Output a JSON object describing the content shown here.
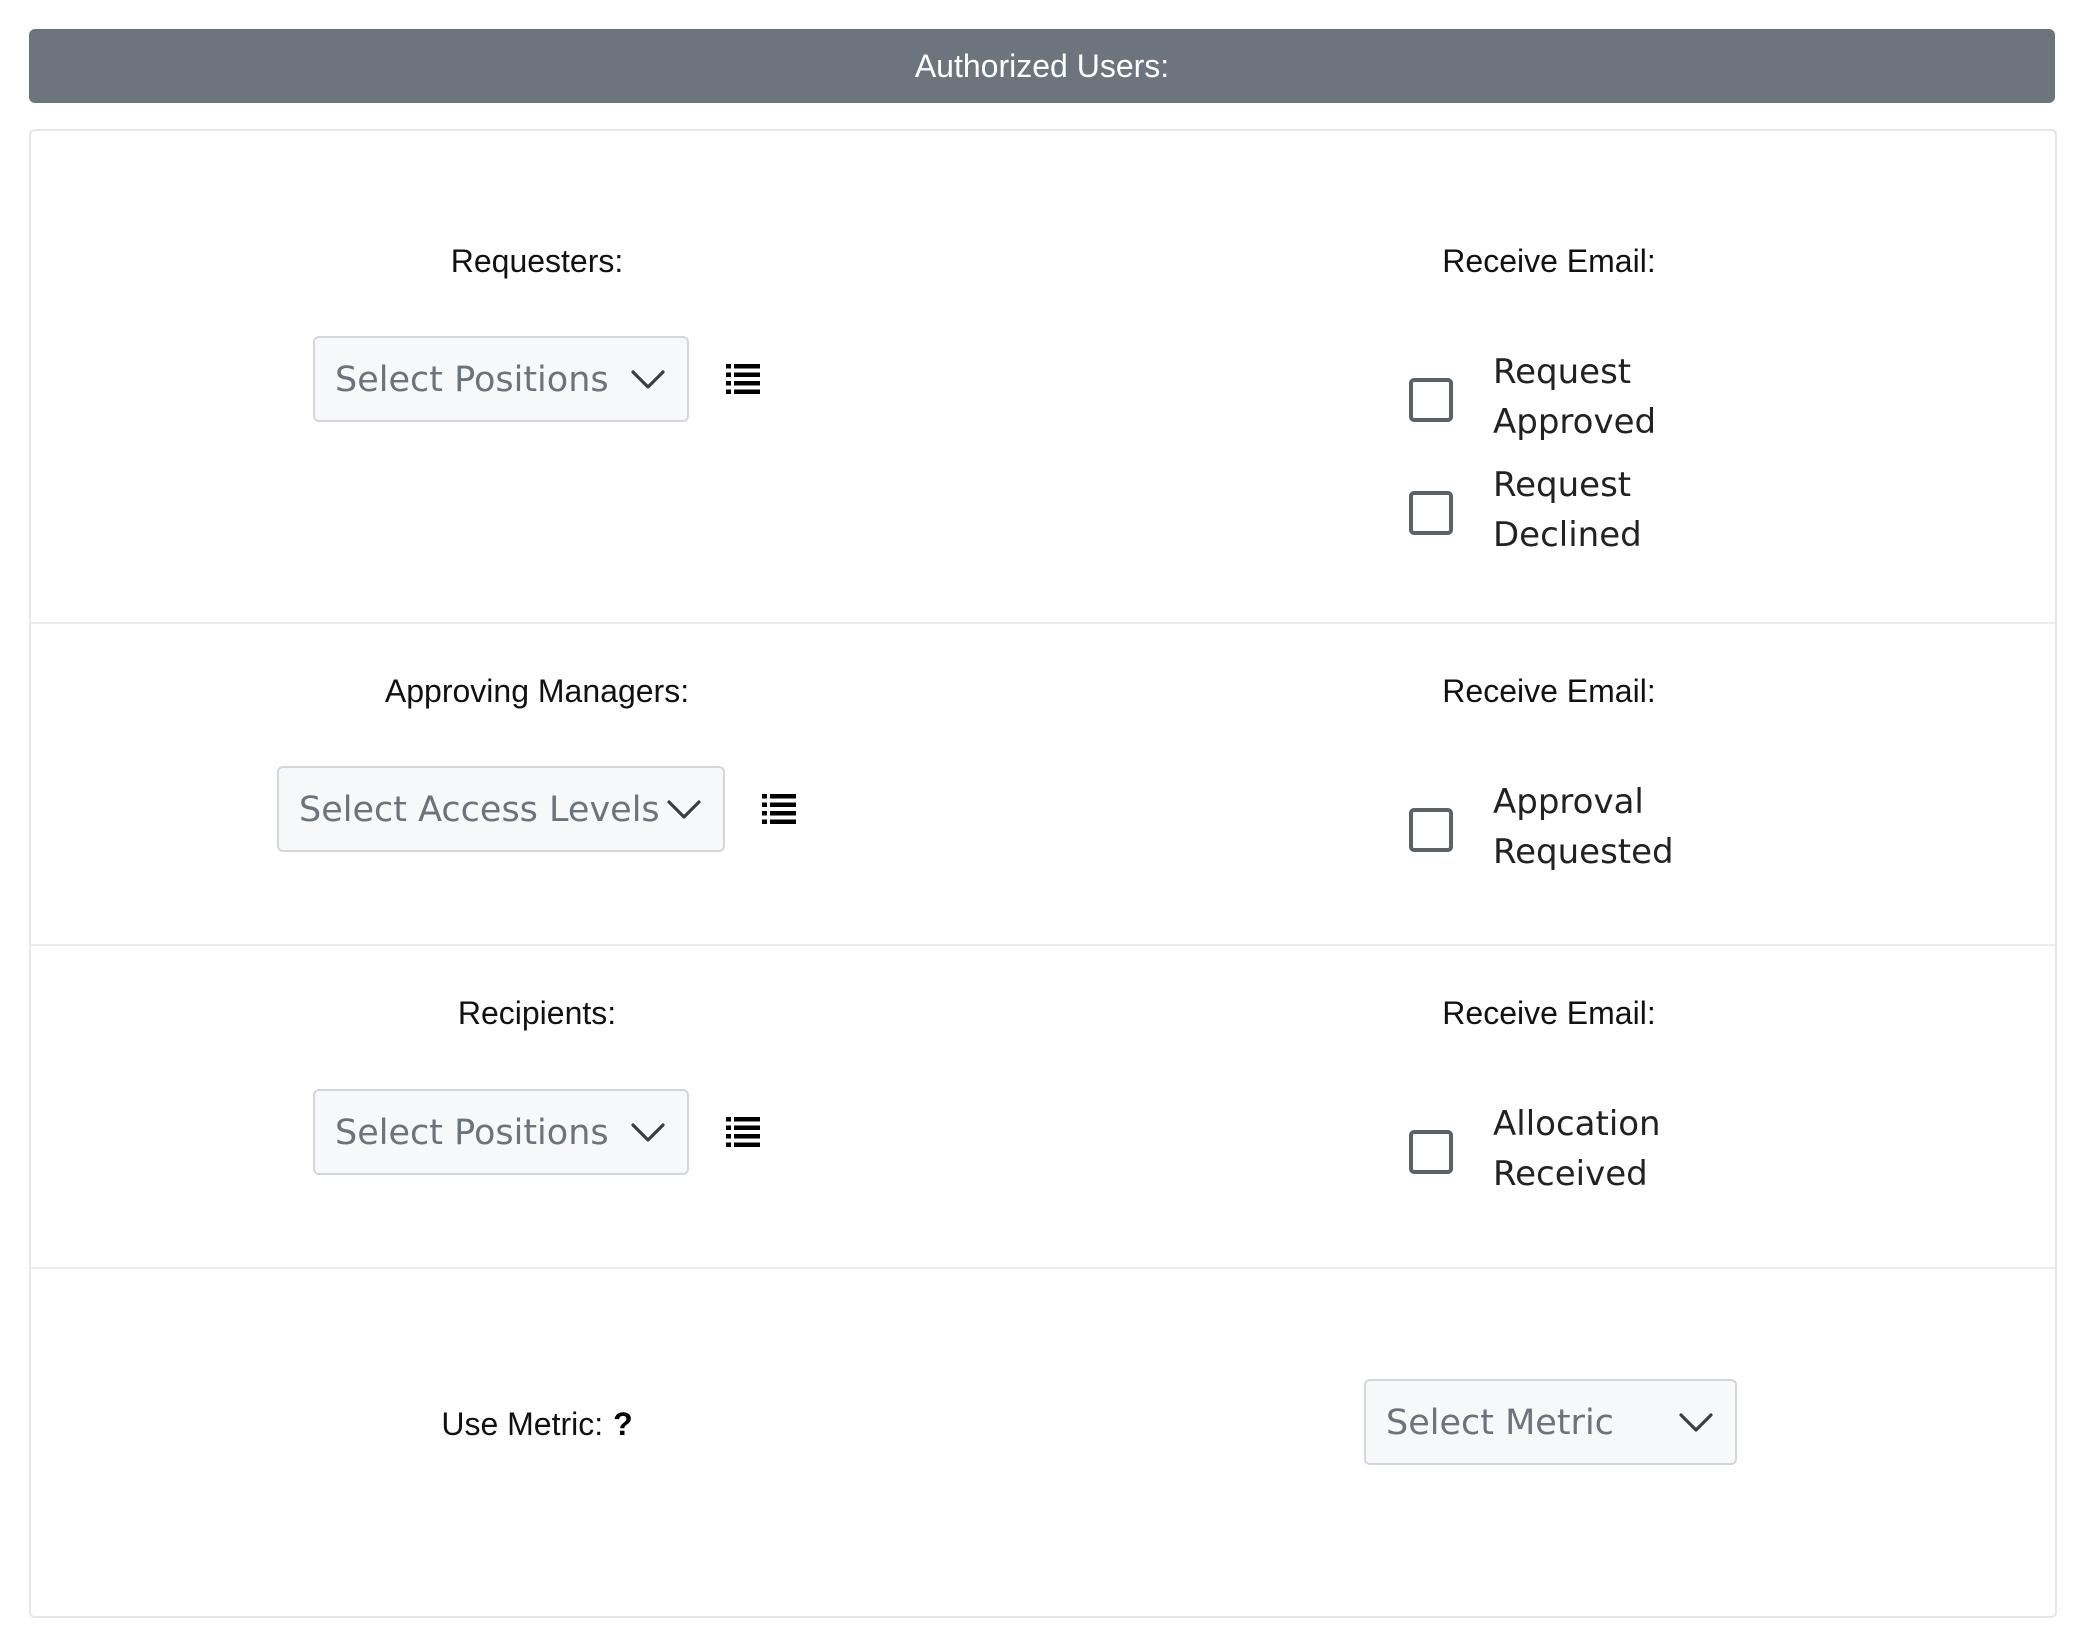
{
  "header": {
    "title": "Authorized Users:"
  },
  "sections": {
    "requesters": {
      "label": "Requesters:",
      "select_placeholder": "Select Positions",
      "email_label": "Receive Email:",
      "checkboxes": [
        {
          "label": "Request Approved",
          "checked": false
        },
        {
          "label": "Request Declined",
          "checked": false
        }
      ]
    },
    "approving_managers": {
      "label": "Approving Managers:",
      "select_placeholder": "Select Access Levels",
      "email_label": "Receive Email:",
      "checkboxes": [
        {
          "label": "Approval Requested",
          "checked": false
        }
      ]
    },
    "recipients": {
      "label": "Recipients:",
      "select_placeholder": "Select Positions",
      "email_label": "Receive Email:",
      "checkboxes": [
        {
          "label": "Allocation Received",
          "checked": false
        }
      ]
    },
    "metric": {
      "label": "Use Metric:",
      "help_glyph": "?",
      "select_placeholder": "Select Metric"
    }
  },
  "icons": {
    "dropdown": "chevron-down-icon",
    "list": "list-icon",
    "help": "help-icon"
  },
  "colors": {
    "header_bg": "#6c757d",
    "header_text": "#ffffff",
    "select_bg": "#f7f8f9",
    "select_border": "#d3d6da",
    "placeholder_text": "#6c737a",
    "checkbox_border": "#5c6166"
  }
}
